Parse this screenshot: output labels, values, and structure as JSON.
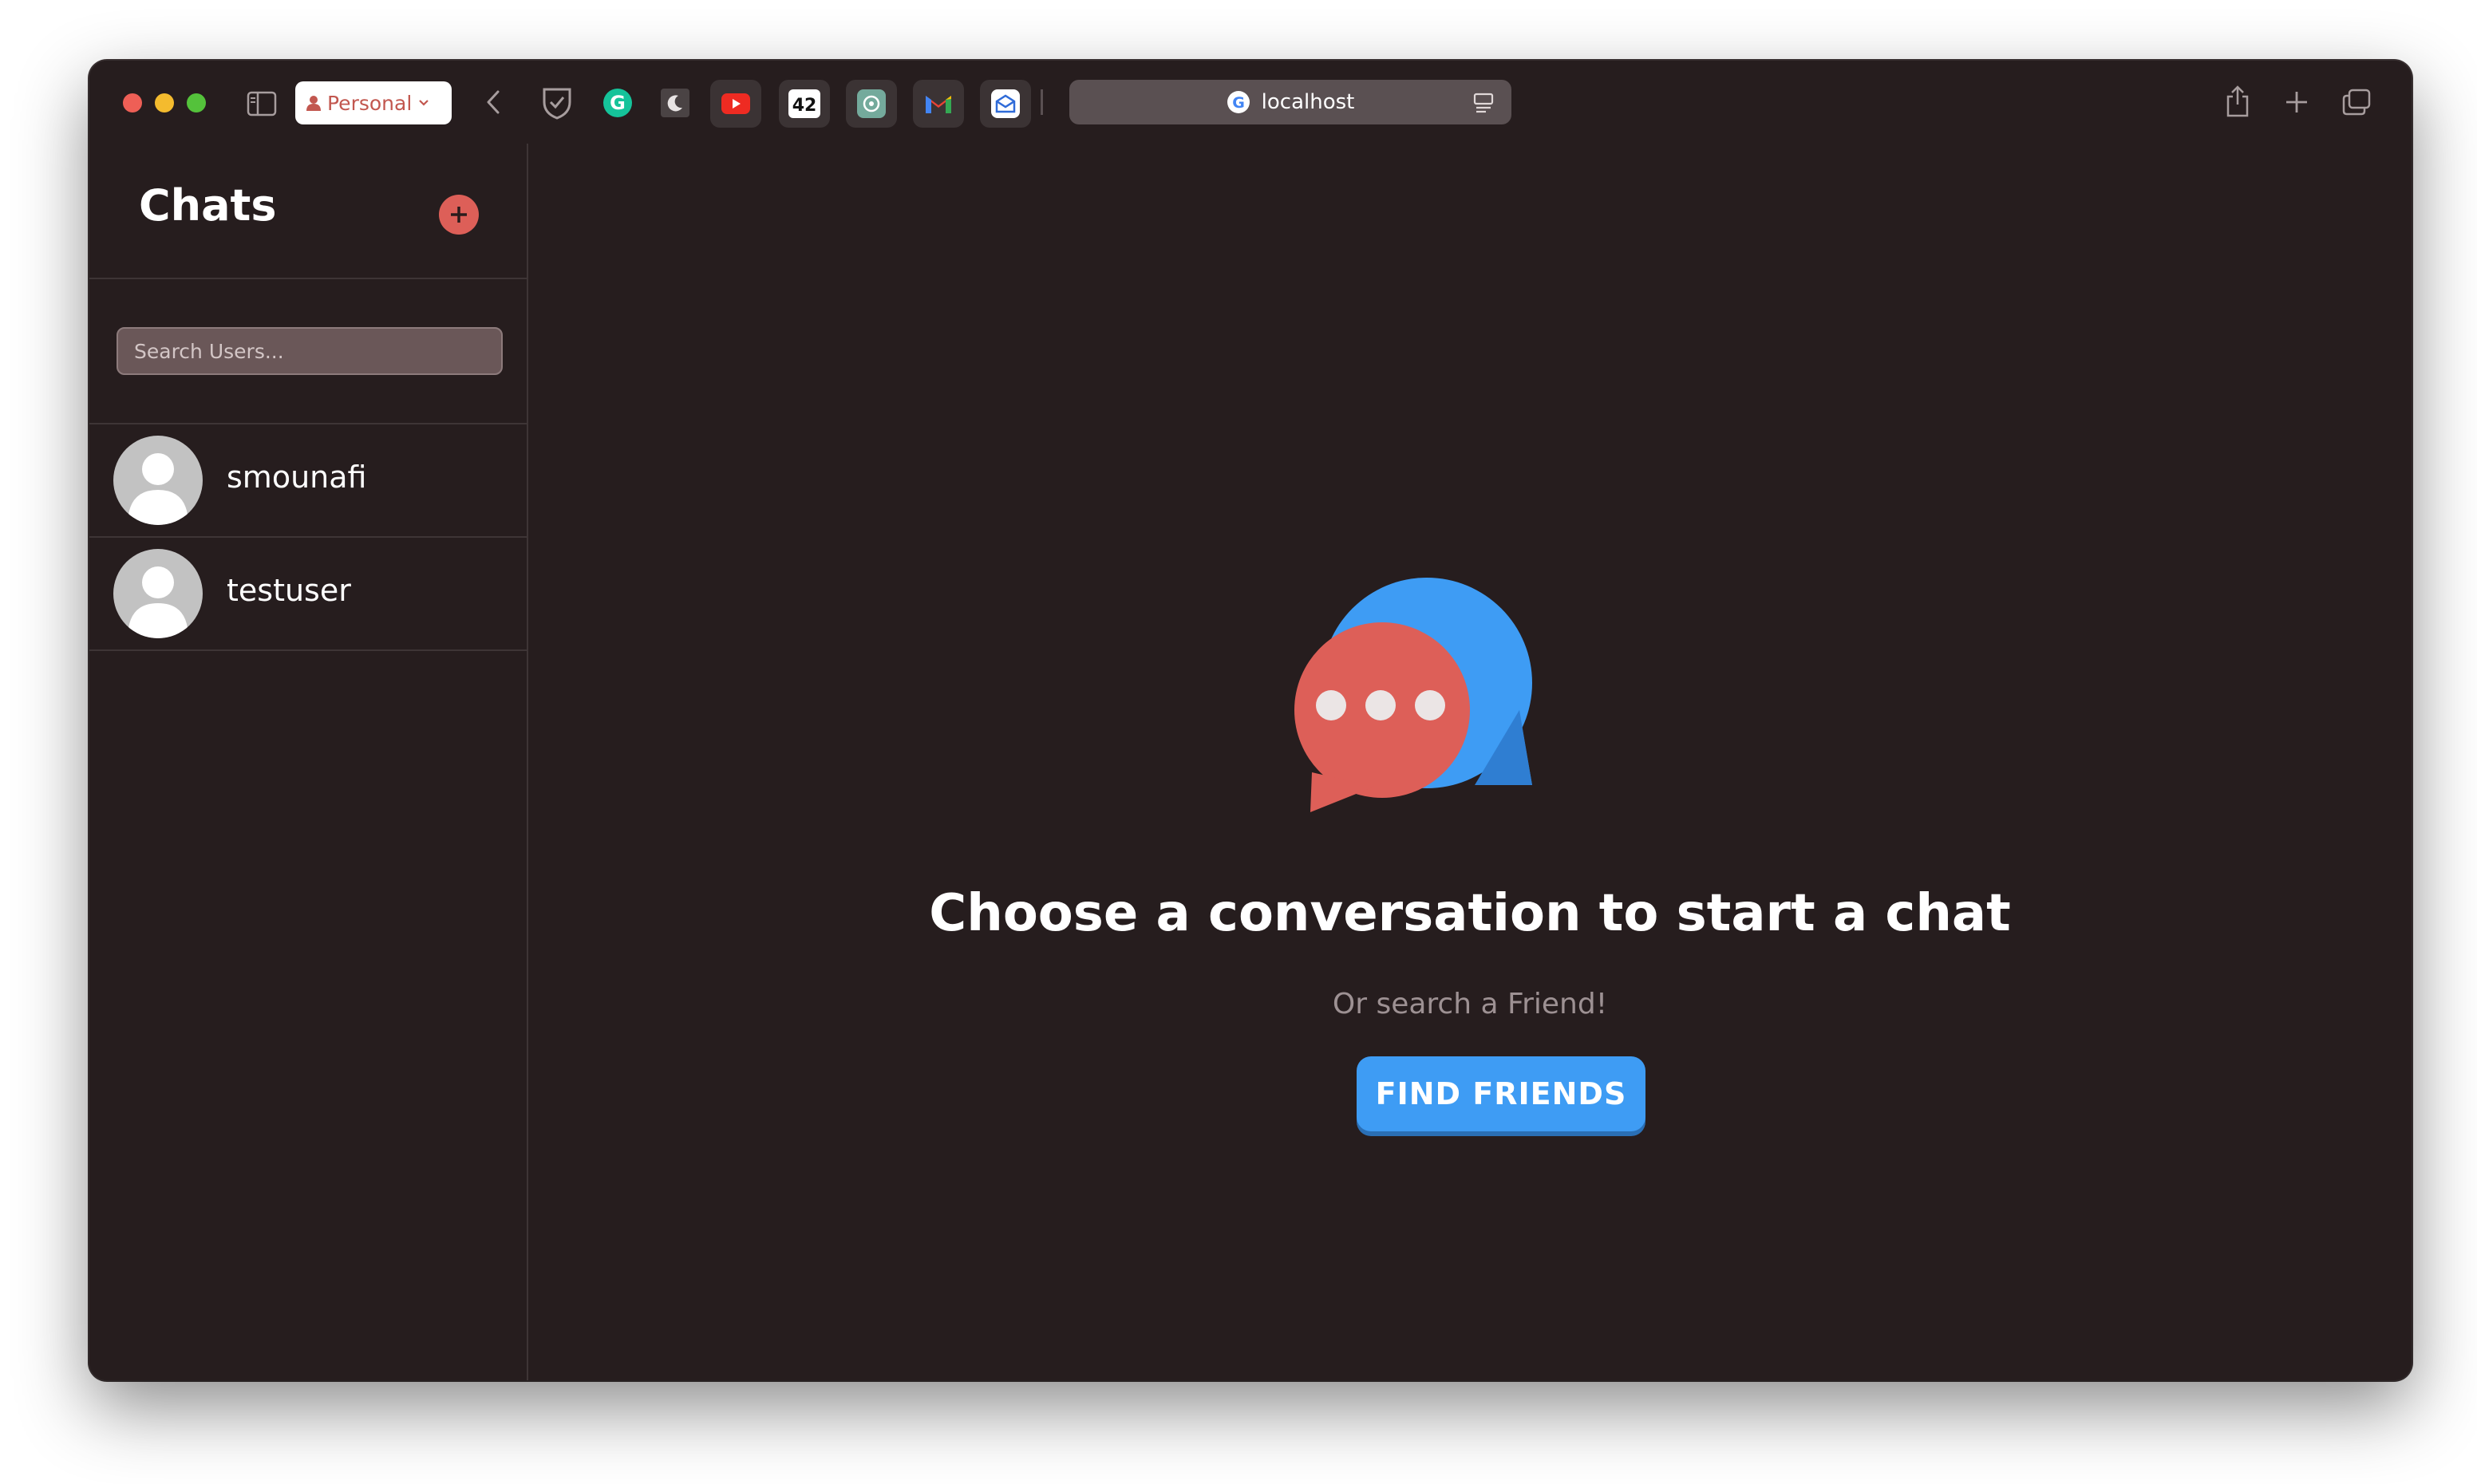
{
  "browser": {
    "profile_label": "Personal",
    "url": "localhost",
    "traffic_lights": {
      "close": "#ee5f56",
      "minimize": "#f4bb2e",
      "maximize": "#54c23b"
    },
    "extensions": [
      "bitwarden-icon",
      "grammarly-icon",
      "dark-mode-icon",
      "youtube-icon",
      "42-icon",
      "chatgpt-icon",
      "gmail-icon",
      "mail-icon"
    ]
  },
  "sidebar": {
    "title": "Chats",
    "search_placeholder": "Search Users...",
    "users": [
      {
        "name": "smounafi"
      },
      {
        "name": "testuser"
      }
    ]
  },
  "main": {
    "title": "Choose a conversation to start a chat",
    "subtitle": "Or search a Friend!",
    "button_label": "FIND FRIENDS"
  },
  "colors": {
    "background": "#261d1e",
    "accent_red": "#dd5f58",
    "accent_blue": "#3e9cf4"
  }
}
